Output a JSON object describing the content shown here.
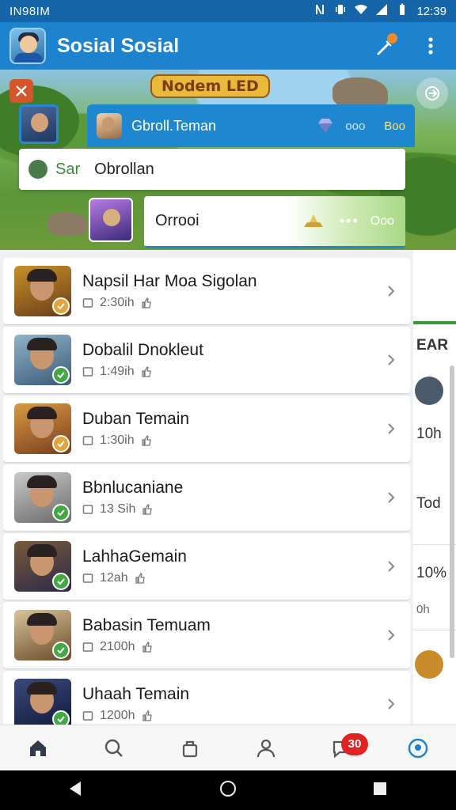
{
  "status_bar": {
    "left_text": "IN98IM",
    "time": "12:39"
  },
  "app_bar": {
    "title": "Sosial Sosial"
  },
  "banner": {
    "logo_text": "Nodem LED",
    "header_card": {
      "title": "Gbroll.Teman",
      "meta_1": "ooo",
      "meta_2": "Boo"
    },
    "search_card": {
      "prefix": "Sar",
      "text": "Obrollan"
    },
    "preview_card": {
      "text": "Orrooi",
      "dots": "•••",
      "num": "Ooo"
    }
  },
  "chat_list": [
    {
      "name": "Napsil Har Moa Sigolan",
      "time": "2:30ih",
      "check_color": "#e6a33c",
      "thumb_colors": [
        "#c8902a",
        "#6a3c18"
      ]
    },
    {
      "name": "Dobalil Dnokleut",
      "time": "1:49ih",
      "check_color": "#43a843",
      "thumb_colors": [
        "#8fb3c8",
        "#3d5a78"
      ]
    },
    {
      "name": "Duban Temain",
      "time": "1:30ih",
      "check_color": "#e6a33c",
      "thumb_colors": [
        "#d89a44",
        "#7a3d1c"
      ]
    },
    {
      "name": "Bbnlucaniane",
      "time": "13 Sih",
      "check_color": "#43a843",
      "thumb_colors": [
        "#c9c9c9",
        "#6a6a6a"
      ]
    },
    {
      "name": "LahhaGemain",
      "time": "12ah",
      "check_color": "#43a843",
      "thumb_colors": [
        "#7a5a3a",
        "#2a2a4a"
      ]
    },
    {
      "name": "Babasin Temuam",
      "time": "2100h",
      "check_color": "#43a843",
      "thumb_colors": [
        "#d8c49a",
        "#6a4a2a"
      ]
    },
    {
      "name": "Uhaah Temain",
      "time": "1200h",
      "check_color": "#43a843",
      "thumb_colors": [
        "#3a4a7a",
        "#12183a"
      ]
    }
  ],
  "peek_panel": {
    "header": "EAR",
    "t1": "10h",
    "t2": "Tod",
    "t3": "10%",
    "t4": "0h"
  },
  "bottom_nav": {
    "badge": "30"
  },
  "colors": {
    "primary": "#1d83cf",
    "status_bar": "#1565a8",
    "badge": "#e02424",
    "check_green": "#43a843"
  }
}
